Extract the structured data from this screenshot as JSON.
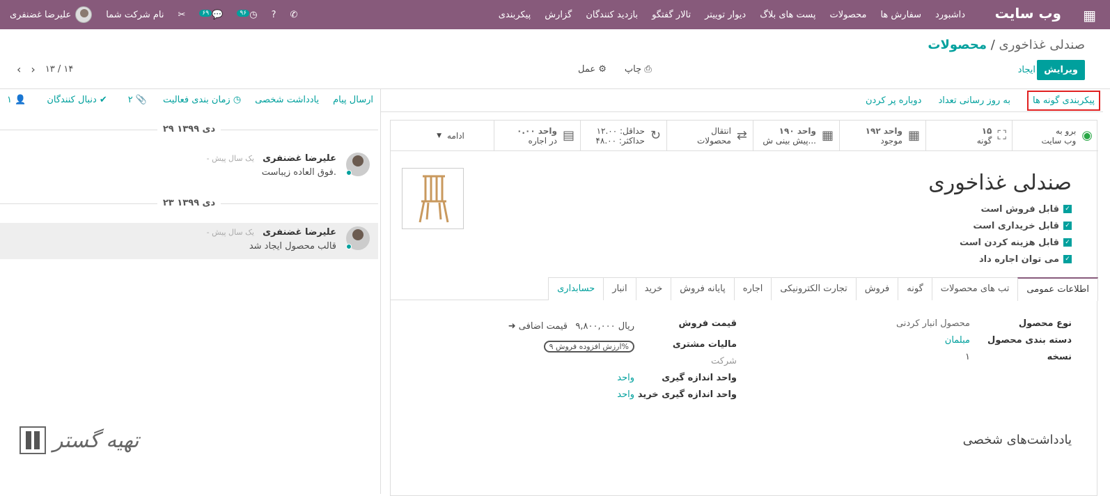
{
  "topbar": {
    "app_icon": "grid-icon",
    "brand": "وب سایت",
    "menu": [
      "داشبورد",
      "سفارش ها",
      "محصولات",
      "پست های بلاگ",
      "دیوار توییتر",
      "تالار گفتگو",
      "بازدید کنندگان",
      "گزارش",
      "پیکربندی"
    ],
    "user_name": "علیرضا غضنفری",
    "company": "نام شرکت شما",
    "badge_activity": "۹۶",
    "badge_chat": "۶۹"
  },
  "breadcrumb": {
    "parent": "محصولات",
    "sep": "/",
    "current": "صندلی غذاخوری"
  },
  "controls": {
    "edit": "ویرایش",
    "create": "ایجاد",
    "print": "چاپ",
    "action": "عمل",
    "pager": "۱۳ / ۱۴"
  },
  "statusbar": {
    "configure_variants": "پیکربندی گونه ها",
    "update_qty": "به روز رسانی تعداد",
    "replenish": "دوباره پر کردن"
  },
  "chatter": {
    "send_message": "ارسال پیام",
    "log_note": "یادداشت شخصی",
    "schedule": "زمان بندی فعالیت",
    "attachments": "۲",
    "follow": "دنبال کنندگان",
    "followers": "۱"
  },
  "smart": [
    {
      "icon": "globe-icon",
      "top": "برو به",
      "bottom": "وب سایت"
    },
    {
      "icon": "sitemap-icon",
      "top": "۱۵",
      "bottom": "گونه"
    },
    {
      "icon": "cubes-icon",
      "top": "۱۹۲ واحد",
      "bottom": "موجود"
    },
    {
      "icon": "cubes-icon",
      "top": "۱۹۰ واحد",
      "bottom": "پیش بینی ش..."
    },
    {
      "icon": "exchange-icon",
      "top": "انتقال",
      "bottom": "محصولات"
    },
    {
      "icon": "refresh-icon",
      "top": "حداقل: ۱۲.۰۰",
      "bottom": "حداکثر: ۴۸.۰۰"
    },
    {
      "icon": "calendar-icon",
      "top": "۰.۰۰ واحد",
      "bottom": "در اجاره"
    },
    {
      "icon": "caret-down-icon",
      "top": "ادامه",
      "bottom": ""
    }
  ],
  "product": {
    "name": "صندلی غذاخوری",
    "checks": [
      "قابل فروش است",
      "قابل خریداری است",
      "قابل هزینه کردن است",
      "می توان اجاره داد"
    ]
  },
  "tabs": [
    "اطلاعات عمومی",
    "تب های محصولات",
    "گونه",
    "فروش",
    "تجارت الکترونیکی",
    "اجاره",
    "پایانه فروش",
    "خرید",
    "انبار",
    "حسابداری"
  ],
  "fields": {
    "type_label": "نوع محصول",
    "type_value": "محصول انبار کردنی",
    "category_label": "دسته بندی محصول",
    "category_value": "مبلمان",
    "version_label": "نسخه",
    "version_value": "۱",
    "price_label": "قیمت فروش",
    "price_value": "۹,۸۰۰,۰۰۰ ریال",
    "extra_price": "قیمت اضافی",
    "tax_label": "مالیات مشتری",
    "tax_value": "ارزش افزوده فروش ۹%",
    "company_label": "شرکت",
    "uom_label": "واحد اندازه گیری",
    "uom_value": "واحد",
    "puom_label": "واحد اندازه گیری خرید",
    "puom_value": "واحد"
  },
  "notes_title": "یادداشت‌های شخصی",
  "messages": [
    {
      "date": "۲۹ دی ۱۳۹۹",
      "author": "علیرضا غضنفری",
      "ago": "- یک سال پیش",
      "body": "فوق العاده زیباست."
    },
    {
      "date": "۲۳ دی ۱۳۹۹",
      "author": "علیرضا غضنفری",
      "ago": "- یک سال پیش",
      "body": "قالب محصول ایجاد شد"
    }
  ],
  "watermark": "تهیه گستر"
}
